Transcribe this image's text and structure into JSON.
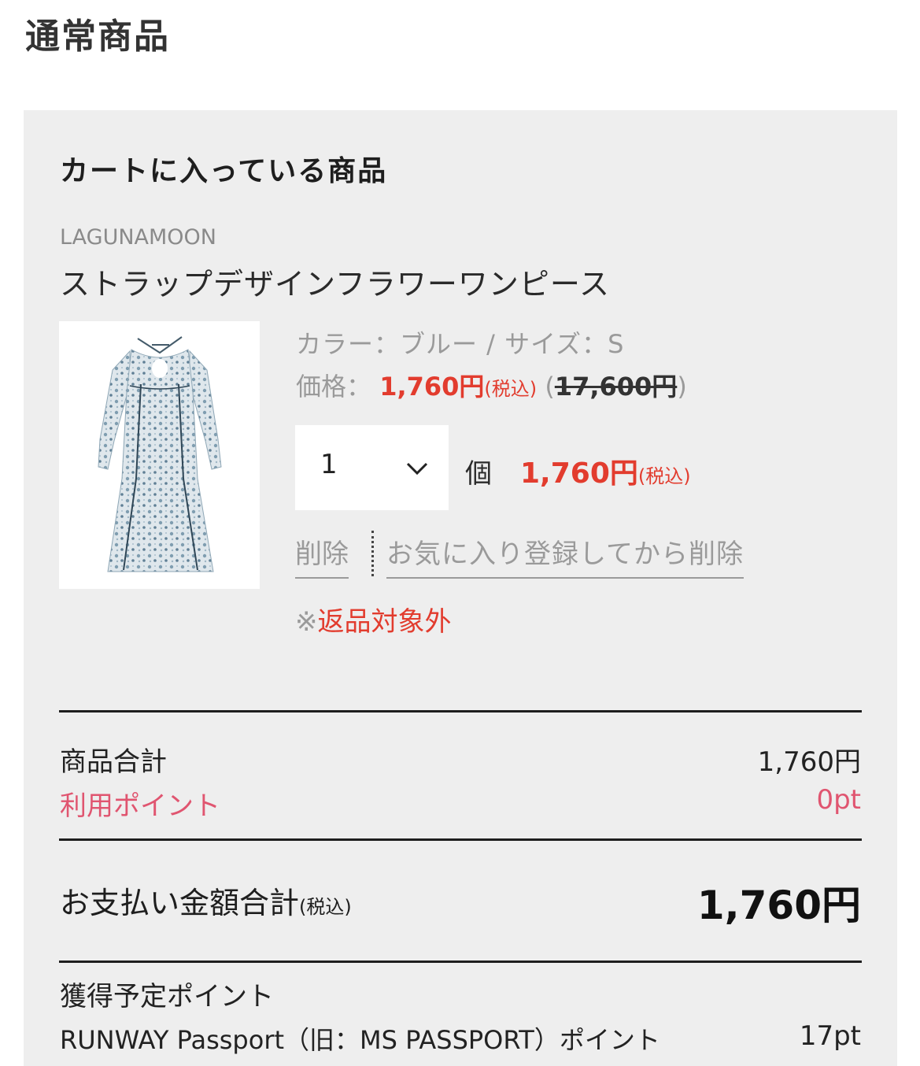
{
  "page_title": "通常商品",
  "cart": {
    "heading": "カートに入っている商品",
    "item": {
      "brand": "LAGUNAMOON",
      "name": "ストラップデザインフラワーワンピース",
      "variant": "カラー：ブルー / サイズ：S",
      "price_label": "価格：",
      "sale_price": "1,760円",
      "tax_label": "(税込)",
      "paren_open": "(",
      "original_price": "17,600円",
      "paren_close": ")",
      "quantity": "1",
      "unit": "個",
      "line_total": "1,760円",
      "line_total_tax": "(税込)",
      "delete_label": "削除",
      "favorite_delete_label": "お気に入り登録してから削除",
      "return_mark": "※",
      "return_note": "返品対象外"
    }
  },
  "summary": {
    "subtotal_label": "商品合計",
    "subtotal_value": "1,760円",
    "points_label": "利用ポイント",
    "points_value": "0pt",
    "total_label": "お支払い金額合計",
    "total_tax": "(税込)",
    "total_value": "1,760円",
    "earn_label": "獲得予定ポイント",
    "passport_label": "RUNWAY Passport（旧：MS PASSPORT）ポイント",
    "passport_value": "17pt"
  },
  "colors": {
    "sale_red": "#e23c2e",
    "points_pink": "#e05570",
    "panel_bg": "#eeeeee"
  },
  "icons": {
    "quantity_dropdown": "chevron-down-icon",
    "product_image": "floral-dress-image"
  }
}
